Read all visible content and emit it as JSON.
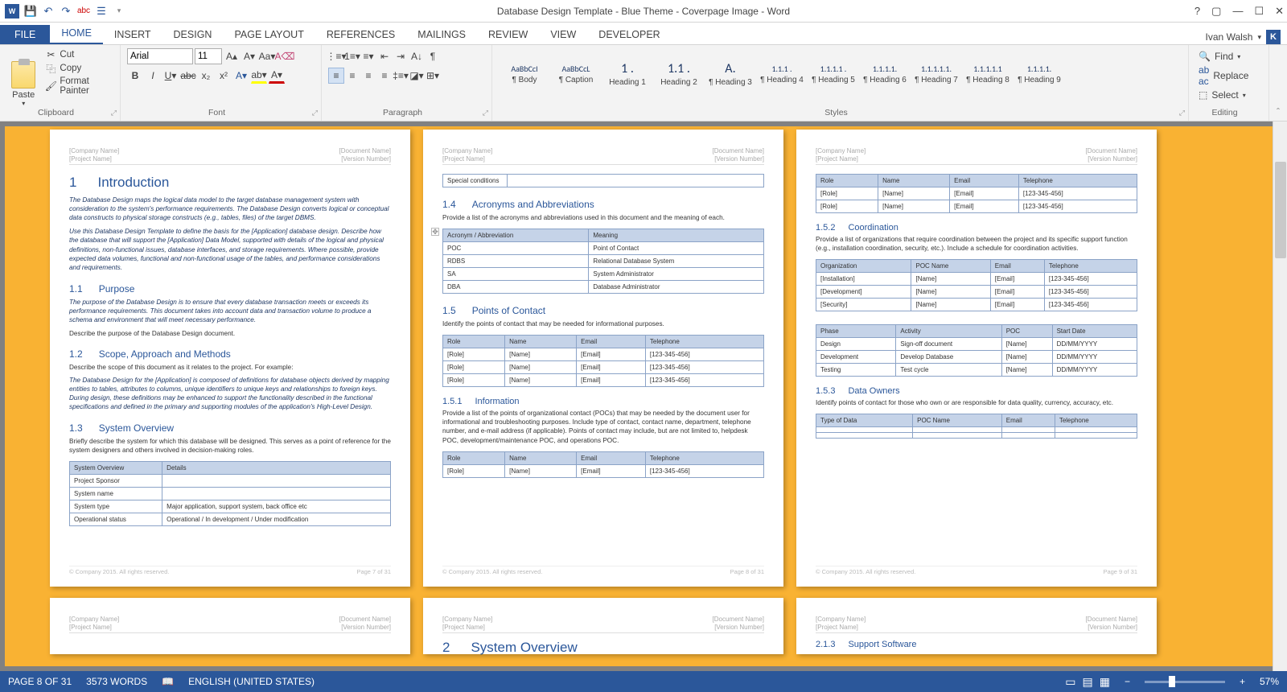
{
  "title": "Database Design Template - Blue Theme - Coverpage Image - Word",
  "user": "Ivan Walsh",
  "user_initial": "K",
  "tabs": {
    "file": "FILE",
    "home": "HOME",
    "insert": "INSERT",
    "design": "DESIGN",
    "pagelayout": "PAGE LAYOUT",
    "references": "REFERENCES",
    "mailings": "MAILINGS",
    "review": "REVIEW",
    "view": "VIEW",
    "developer": "DEVELOPER"
  },
  "ribbon": {
    "paste": "Paste",
    "cut": "Cut",
    "copy": "Copy",
    "fpainter": "Format Painter",
    "clipboard": "Clipboard",
    "font": "Font",
    "fontname": "Arial",
    "fontsize": "11",
    "para": "Paragraph",
    "styles_label": "Styles",
    "styles": [
      {
        "preview": "AaBbCcI",
        "name": "¶ Body"
      },
      {
        "preview": "AaBbCcL",
        "name": "¶ Caption"
      },
      {
        "preview": "1 .",
        "name": "Heading 1"
      },
      {
        "preview": "1.1 .",
        "name": "Heading 2"
      },
      {
        "preview": "A.",
        "name": "¶ Heading 3"
      },
      {
        "preview": "1.1.1 .",
        "name": "¶ Heading 4"
      },
      {
        "preview": "1.1.1.1 .",
        "name": "¶ Heading 5"
      },
      {
        "preview": "1.1.1.1.",
        "name": "¶ Heading 6"
      },
      {
        "preview": "1.1.1.1.1.",
        "name": "¶ Heading 7"
      },
      {
        "preview": "1.1.1.1.1",
        "name": "¶ Heading 8"
      },
      {
        "preview": "1.1.1.1.",
        "name": "¶ Heading 9"
      }
    ],
    "find": "Find",
    "replace": "Replace",
    "select": "Select",
    "editing": "Editing"
  },
  "hdr": {
    "company": "[Company Name]",
    "project": "[Project Name]",
    "doc": "[Document Name]",
    "ver": "[Version Number]"
  },
  "page7": {
    "h1_num": "1",
    "h1": "Introduction",
    "para1": "The Database Design maps the logical data model to the target database management system with consideration to the system's performance requirements. The Database Design converts logical or conceptual data constructs to physical storage constructs (e.g., tables, files) of the target DBMS.",
    "para2": "Use this Database Design Template to define the basis for the [Application] database design. Describe how the database that will support the [Application] Data Model, supported with details of the logical and physical definitions, non-functional issues, database interfaces, and storage requirements. Where possible, provide expected data volumes, functional and non-functional usage of the tables, and performance considerations and requirements.",
    "h11_num": "1.1",
    "h11": "Purpose",
    "para3": "The purpose of the Database Design is to ensure that every database transaction meets or exceeds its performance requirements. This document takes into account data and transaction volume to produce a schema and environment that will meet necessary performance.",
    "para4": "Describe the purpose of the Database Design document.",
    "h12_num": "1.2",
    "h12": "Scope, Approach and Methods",
    "para5": "Describe the scope of this document as it relates to the project. For example:",
    "para6": "The Database Design for the [Application] is composed of definitions for database objects derived by mapping entities to tables, attributes to columns, unique identifiers to unique keys and relationships to foreign keys. During design, these definitions may be enhanced to support the functionality described in the functional specifications and defined in the primary and supporting modules of the application's High-Level Design.",
    "h13_num": "1.3",
    "h13": "System Overview",
    "para7": "Briefly describe the system for which this database will be designed. This serves as a point of reference for the system designers and others involved in decision-making roles.",
    "table": {
      "h1": "System Overview",
      "h2": "Details",
      "rows": [
        [
          "Project Sponsor",
          ""
        ],
        [
          "System name",
          ""
        ],
        [
          "System type",
          "Major application, support system, back office etc"
        ],
        [
          "Operational status",
          "Operational / In development / Under modification"
        ]
      ]
    },
    "foot_l": "© Company 2015. All rights reserved.",
    "foot_r": "Page 7 of 31"
  },
  "page8": {
    "special": "Special conditions",
    "h14_num": "1.4",
    "h14": "Acronyms and Abbreviations",
    "para1": "Provide a list of the acronyms and abbreviations used in this document and the meaning of each.",
    "acr": {
      "h1": "Acronym / Abbreviation",
      "h2": "Meaning",
      "rows": [
        [
          "POC",
          "Point of Contact"
        ],
        [
          "RDBS",
          "Relational Database System"
        ],
        [
          "SA",
          "System Administrator"
        ],
        [
          "DBA",
          "Database Administrator"
        ]
      ]
    },
    "h15_num": "1.5",
    "h15": "Points of Contact",
    "para2": "Identify the points of contact that may be needed for informational purposes.",
    "poc": {
      "h1": "Role",
      "h2": "Name",
      "h3": "Email",
      "h4": "Telephone",
      "rows": [
        [
          "[Role]",
          "[Name]",
          "[Email]",
          "[123-345-456]"
        ],
        [
          "[Role]",
          "[Name]",
          "[Email]",
          "[123-345-456]"
        ],
        [
          "[Role]",
          "[Name]",
          "[Email]",
          "[123-345-456]"
        ]
      ]
    },
    "h151_num": "1.5.1",
    "h151": "Information",
    "para3": "Provide a list of the points of organizational contact (POCs) that may be needed by the document user for informational and troubleshooting purposes. Include type of contact, contact name, department, telephone number, and e-mail address (if applicable). Points of contact may include, but are not limited to, helpdesk POC, development/maintenance POC, and operations POC.",
    "poc2": {
      "h1": "Role",
      "h2": "Name",
      "h3": "Email",
      "h4": "Telephone",
      "rows": [
        [
          "[Role]",
          "[Name]",
          "[Email]",
          "[123-345-456]"
        ]
      ]
    },
    "foot_l": "© Company 2015. All rights reserved.",
    "foot_r": "Page 8 of 31",
    "next_h1_num": "2",
    "next_h1": "System Overview"
  },
  "page9": {
    "role_tbl": {
      "h1": "Role",
      "h2": "Name",
      "h3": "Email",
      "h4": "Telephone",
      "rows": [
        [
          "[Role]",
          "[Name]",
          "[Email]",
          "[123-345-456]"
        ],
        [
          "[Role]",
          "[Name]",
          "[Email]",
          "[123-345-456]"
        ]
      ]
    },
    "h152_num": "1.5.2",
    "h152": "Coordination",
    "para1": "Provide a list of organizations that require coordination between the project and its specific support function (e.g., installation coordination, security, etc.). Include a schedule for coordination activities.",
    "coord": {
      "h1": "Organization",
      "h2": "POC Name",
      "h3": "Email",
      "h4": "Telephone",
      "rows": [
        [
          "[Installation]",
          "[Name]",
          "[Email]",
          "[123-345-456]"
        ],
        [
          "[Development]",
          "[Name]",
          "[Email]",
          "[123-345-456]"
        ],
        [
          "[Security]",
          "[Name]",
          "[Email]",
          "[123-345-456]"
        ]
      ]
    },
    "phase": {
      "h1": "Phase",
      "h2": "Activity",
      "h3": "POC",
      "h4": "Start Date",
      "rows": [
        [
          "Design",
          "Sign-off document",
          "[Name]",
          "DD/MM/YYYY"
        ],
        [
          "Development",
          "Develop Database",
          "[Name]",
          "DD/MM/YYYY"
        ],
        [
          "Testing",
          "Test cycle",
          "[Name]",
          "DD/MM/YYYY"
        ]
      ]
    },
    "h153_num": "1.5.3",
    "h153": "Data Owners",
    "para2": "Identify points of contact for those who own or are responsible for data quality, currency, accuracy, etc.",
    "owners": {
      "h1": "Type of Data",
      "h2": "POC Name",
      "h3": "Email",
      "h4": "Telephone",
      "rows": [
        [
          "",
          "",
          "",
          ""
        ],
        [
          "",
          "",
          "",
          ""
        ]
      ]
    },
    "foot_l": "© Company 2015. All rights reserved.",
    "foot_r": "Page 9 of 31",
    "next_num": "2.1.3",
    "next": "Support Software"
  },
  "status": {
    "page": "PAGE 8 OF 31",
    "words": "3573 WORDS",
    "lang": "ENGLISH (UNITED STATES)",
    "zoom": "57%"
  }
}
